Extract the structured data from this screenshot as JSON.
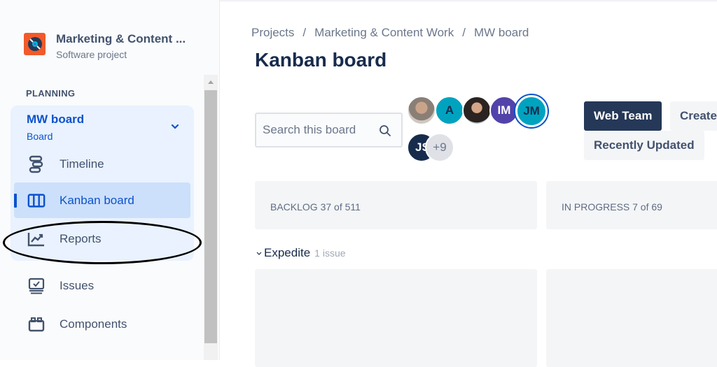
{
  "project": {
    "name": "Marketing & Content ...",
    "type": "Software project",
    "icon": "project-vinyl-icon",
    "icon_bg": "#f15a2b"
  },
  "sidebar": {
    "section_label": "PLANNING",
    "board_selector": {
      "title": "MW board",
      "subtitle": "Board"
    },
    "items": [
      {
        "label": "Timeline",
        "icon": "timeline-icon",
        "active": false
      },
      {
        "label": "Kanban board",
        "icon": "kanban-board-icon",
        "active": true
      },
      {
        "label": "Reports",
        "icon": "reports-icon",
        "active": false,
        "highlighted": true
      },
      {
        "label": "Issues",
        "icon": "issues-icon",
        "active": false
      },
      {
        "label": "Components",
        "icon": "components-icon",
        "active": false
      }
    ]
  },
  "breadcrumb": [
    "Projects",
    "Marketing & Content Work",
    "MW board"
  ],
  "page_title": "Kanban board",
  "search": {
    "placeholder": "Search this board",
    "value": ""
  },
  "avatars": [
    {
      "initials": "",
      "type": "photo",
      "color": "#8a7f76"
    },
    {
      "initials": "A",
      "type": "initials",
      "color": "#00a3bf",
      "text_color": "#172b4d"
    },
    {
      "initials": "",
      "type": "photo",
      "color": "#4a3c36"
    },
    {
      "initials": "IM",
      "type": "initials",
      "color": "#5243aa",
      "text_color": "#ffffff"
    },
    {
      "initials": "JM",
      "type": "initials",
      "color": "#00a3bf",
      "text_color": "#172b4d",
      "selected": true
    },
    {
      "initials": "JS",
      "type": "initials",
      "color": "#172b4d",
      "text_color": "#ffffff"
    },
    {
      "initials": "+9",
      "type": "overflow",
      "color": "#dfe1e6",
      "text_color": "#6b778c"
    }
  ],
  "filters": [
    {
      "label": "Web Team",
      "selected": true
    },
    {
      "label": "Create",
      "selected": false
    },
    {
      "label": "Recently Updated",
      "selected": false
    }
  ],
  "columns": [
    {
      "label": "BACKLOG 37 of 511"
    },
    {
      "label": "IN PROGRESS 7 of 69"
    }
  ],
  "swimlane": {
    "name": "Expedite",
    "count": "1 issue"
  },
  "colors": {
    "accent": "#0c52cc",
    "text_primary": "#172b4d",
    "text_secondary": "#42526e"
  }
}
